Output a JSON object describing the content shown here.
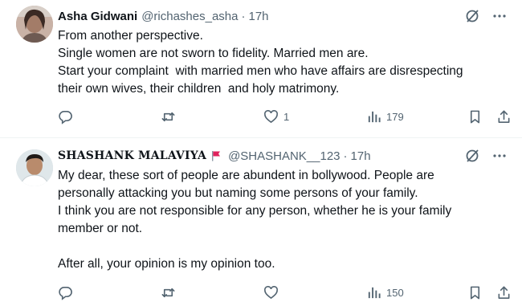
{
  "tweets": [
    {
      "name": "Asha Gidwani",
      "handle": "@richashes_asha",
      "separator": "·",
      "time": "17h",
      "lines": [
        "From another perspective.",
        "Single women are not sworn to fidelity. Married men are.",
        "Start your complaint  with married men who have affairs are disrespecting",
        "their own wives, their children  and holy matrimony."
      ],
      "actions": {
        "reply_count": "",
        "retweet_count": "",
        "like_count": "1",
        "view_count": "179"
      }
    },
    {
      "name": "SHASHANK MALAVIYA",
      "handle": "@SHASHANK__123",
      "separator": "·",
      "time": "17h",
      "lines": [
        "My dear, these sort of people are abundent in bollywood. People are",
        "personally attacking you but naming some persons of your family.",
        "I think you are not responsible for any person, whether he is your family",
        "member or not.",
        "",
        "After all, your opinion is my opinion too."
      ],
      "actions": {
        "reply_count": "",
        "retweet_count": "",
        "like_count": "",
        "view_count": "150"
      }
    }
  ],
  "icons": {
    "grok": "grok-icon",
    "more": "more-icon",
    "reply": "reply-icon",
    "retweet": "retweet-icon",
    "like": "heart-icon",
    "views": "views-icon",
    "bookmark": "bookmark-icon",
    "share": "share-icon",
    "flag": "red-flag-icon"
  },
  "colors": {
    "text": "#0f1419",
    "secondary": "#536471",
    "divider": "#eff3f4",
    "flag": "#e0245e"
  }
}
